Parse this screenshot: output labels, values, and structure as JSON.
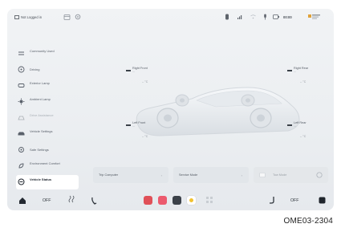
{
  "status_bar": {
    "login_text": "Not Logged in",
    "time": "00:00"
  },
  "sidebar": {
    "items": [
      {
        "label": "Community Used",
        "icon": "community-icon",
        "state": "normal"
      },
      {
        "label": "Driving",
        "icon": "steering-wheel-icon",
        "state": "normal"
      },
      {
        "label": "Exterior Lamp",
        "icon": "exterior-lamp-icon",
        "state": "normal"
      },
      {
        "label": "Ambient Lamp",
        "icon": "ambient-lamp-icon",
        "state": "normal"
      },
      {
        "label": "Drive Assistance",
        "icon": "drive-assist-icon",
        "state": "dim"
      },
      {
        "label": "Vehicle Settings",
        "icon": "car-icon",
        "state": "normal"
      },
      {
        "label": "Safe Settings",
        "icon": "safe-icon",
        "state": "normal"
      },
      {
        "label": "Environment Comfort",
        "icon": "comfort-icon",
        "state": "normal"
      },
      {
        "label": "Vehicle Status",
        "icon": "vehicle-status-icon",
        "state": "active"
      }
    ]
  },
  "tires": {
    "right_front": {
      "name": "Right Front",
      "value": "-- °C"
    },
    "right_rear": {
      "name": "Right Rear",
      "value": "-- °C"
    },
    "left_front": {
      "name": "Left Front",
      "value": "-- °C"
    },
    "left_rear": {
      "name": "Left Rear",
      "value": "-- °C"
    }
  },
  "cards": {
    "trip_computer": "Trip Computer",
    "service_mode": "Service Mode",
    "tow_mode": "Tow Mode"
  },
  "dock": {
    "left_temp": "OFF",
    "right_temp": "OFF"
  },
  "caption": "OME03-2304",
  "colors": {
    "screen_bg": "#eceff2",
    "active_item_bg": "#ffffff",
    "text_dark": "#30363d"
  }
}
